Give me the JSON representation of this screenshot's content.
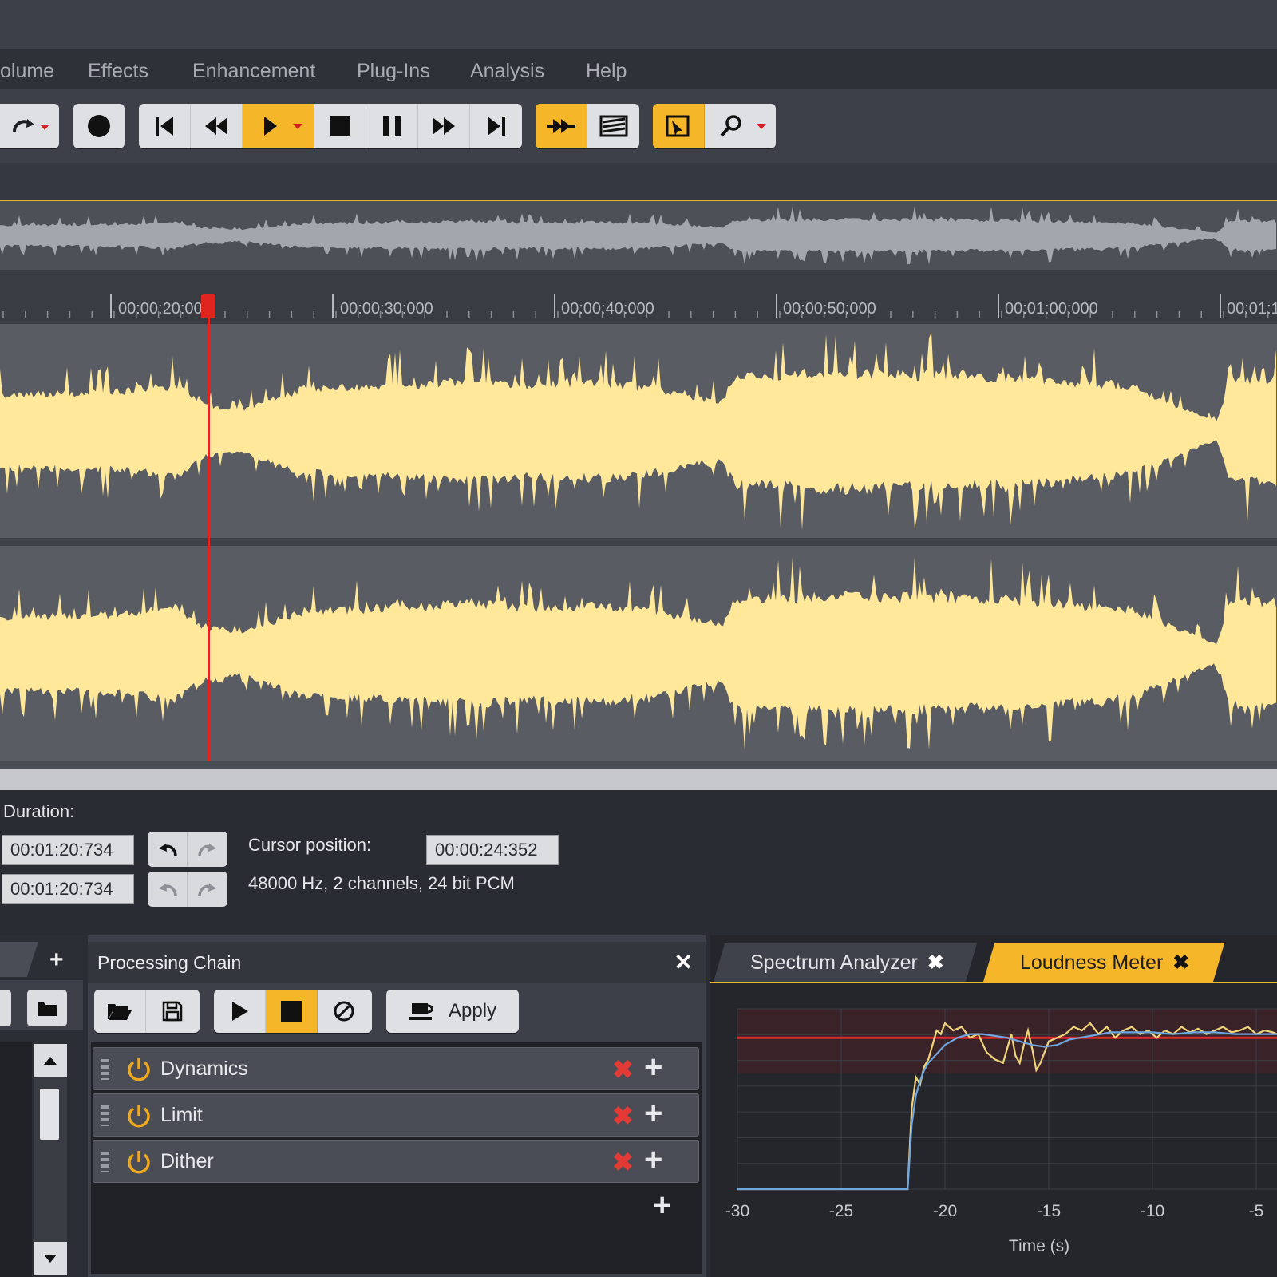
{
  "menu": {
    "items": [
      "olume",
      "Effects",
      "Enhancement",
      "Plug-Ins",
      "Analysis",
      "Help"
    ]
  },
  "toolbar": {
    "buttons": [
      "redo",
      "record",
      "go-to-start",
      "rewind",
      "play",
      "stop",
      "pause",
      "fast-forward",
      "go-to-end",
      "cut-mode",
      "spectral-display",
      "selection-tool",
      "zoom"
    ],
    "accent_color": "#f5b62a"
  },
  "ruler": {
    "labels": [
      "00:00:20:000",
      "00:00:30:000",
      "00:00:40:000",
      "00:00:50:000",
      "00:01:00:000",
      "00:01:1"
    ]
  },
  "waveform": {
    "color": "#ffe89a",
    "playhead_color": "#e0241f"
  },
  "info": {
    "duration_label": "Duration:",
    "duration_value_1": "00:01:20:734",
    "duration_value_2": "00:01:20:734",
    "cursor_label": "Cursor position:",
    "cursor_value": "00:00:24:352",
    "format_text": "48000 Hz, 2 channels, 24 bit PCM"
  },
  "processing_chain": {
    "title": "Processing Chain",
    "apply_label": "Apply",
    "items": [
      {
        "name": "Dynamics"
      },
      {
        "name": "Limit"
      },
      {
        "name": "Dither"
      }
    ]
  },
  "analyzer": {
    "tabs": [
      {
        "label": "Spectrum Analyzer",
        "active": false
      },
      {
        "label": "Loudness Meter",
        "active": true
      }
    ],
    "chart_data": {
      "type": "line",
      "xlabel": "Time (s)",
      "x_ticks": [
        "-30",
        "-25",
        "-20",
        "-15",
        "-10",
        "-5"
      ],
      "xlim": [
        -30,
        -4
      ],
      "ylim": [
        0,
        1
      ],
      "reference_level": 0.84,
      "series": [
        {
          "color": "#f2d57a",
          "x": [
            -30,
            -21.8,
            -21.6,
            -21.4,
            -21.2,
            -21,
            -20.8,
            -20.6,
            -20.4,
            -20.2,
            -20,
            -19.6,
            -19.2,
            -18.8,
            -18.4,
            -18,
            -17.6,
            -17.2,
            -16.8,
            -16.6,
            -16.4,
            -16.2,
            -16,
            -15.8,
            -15.6,
            -15.4,
            -15,
            -14.6,
            -14.2,
            -13.8,
            -13.4,
            -13,
            -12.6,
            -12.2,
            -11.8,
            -11.4,
            -11,
            -10.6,
            -10.2,
            -9.8,
            -9.4,
            -9,
            -8.6,
            -8.2,
            -7.8,
            -7.4,
            -7,
            -6.6,
            -6.2,
            -5.8,
            -5.4,
            -5,
            -4.6,
            -4.2,
            -4
          ],
          "y": [
            0,
            0,
            0.45,
            0.62,
            0.58,
            0.68,
            0.72,
            0.8,
            0.88,
            0.86,
            0.92,
            0.88,
            0.9,
            0.84,
            0.86,
            0.76,
            0.72,
            0.7,
            0.86,
            0.74,
            0.7,
            0.8,
            0.88,
            0.78,
            0.66,
            0.7,
            0.82,
            0.84,
            0.86,
            0.9,
            0.88,
            0.92,
            0.86,
            0.9,
            0.84,
            0.88,
            0.9,
            0.86,
            0.88,
            0.84,
            0.88,
            0.86,
            0.9,
            0.87,
            0.89,
            0.86,
            0.88,
            0.9,
            0.87,
            0.88,
            0.9,
            0.86,
            0.88,
            0.87,
            0.86
          ]
        },
        {
          "color": "#6fa6e0",
          "x": [
            -30,
            -21.8,
            -21.6,
            -21.4,
            -21.2,
            -21,
            -20.8,
            -20.4,
            -20,
            -19.4,
            -18.8,
            -18.2,
            -17.6,
            -17,
            -16.4,
            -15.8,
            -15.2,
            -14.6,
            -14,
            -13,
            -12,
            -11,
            -10,
            -9,
            -8,
            -7,
            -6,
            -5,
            -4
          ],
          "y": [
            0,
            0,
            0.36,
            0.52,
            0.6,
            0.66,
            0.7,
            0.75,
            0.8,
            0.84,
            0.86,
            0.86,
            0.85,
            0.84,
            0.82,
            0.8,
            0.79,
            0.8,
            0.83,
            0.85,
            0.87,
            0.87,
            0.87,
            0.86,
            0.87,
            0.87,
            0.86,
            0.86,
            0.86
          ]
        }
      ]
    }
  }
}
